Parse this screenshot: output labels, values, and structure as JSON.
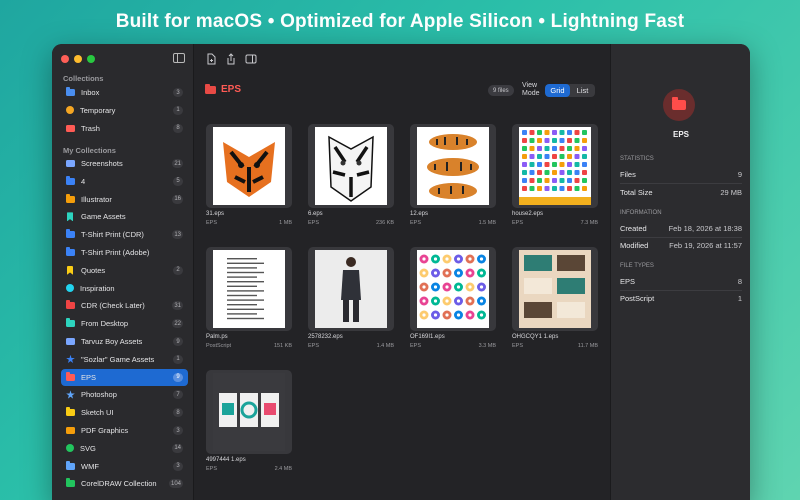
{
  "headline": "Built for macOS • Optimized for Apple Silicon • Lightning Fast",
  "sidebar": {
    "collections_title": "Collections",
    "collections": [
      {
        "label": "Inbox",
        "count": "3",
        "icon": "tray-icon",
        "color": "#4a8ef0"
      },
      {
        "label": "Temporary",
        "count": "1",
        "icon": "clock-icon",
        "color": "#f5a623"
      },
      {
        "label": "Trash",
        "count": "8",
        "icon": "trash-icon",
        "color": "#ff5b55"
      }
    ],
    "my_collections_title": "My Collections",
    "my_collections": [
      {
        "label": "Screenshots",
        "count": "21",
        "icon": "paperclip-icon",
        "color": "#7aa6ff"
      },
      {
        "label": "4",
        "count": "5",
        "icon": "folder-icon",
        "color": "#3b82f6"
      },
      {
        "label": "Illustrator",
        "count": "16",
        "icon": "folder-icon",
        "color": "#f59e0b"
      },
      {
        "label": "Game Assets",
        "count": "",
        "icon": "bookmark-icon",
        "color": "#2dd4bf"
      },
      {
        "label": "T-Shirt Print (CDR)",
        "count": "13",
        "icon": "folder-icon",
        "color": "#3b82f6"
      },
      {
        "label": "T-Shirt Print (Adobe)",
        "count": "",
        "icon": "folder-icon",
        "color": "#3b82f6"
      },
      {
        "label": "Quotes",
        "count": "2",
        "icon": "bookmark-icon",
        "color": "#facc15"
      },
      {
        "label": "Inspiration",
        "count": "",
        "icon": "heart-icon",
        "color": "#22d3ee"
      },
      {
        "label": "CDR (Check Later)",
        "count": "31",
        "icon": "folder-icon",
        "color": "#ef4444"
      },
      {
        "label": "From Desktop",
        "count": "22",
        "icon": "folder-icon",
        "color": "#2dd4bf"
      },
      {
        "label": "Tarvuz Boy Assets",
        "count": "9",
        "icon": "paperclip-icon",
        "color": "#7aa6ff"
      },
      {
        "label": "\"Sozlar\" Game Assets",
        "count": "1",
        "icon": "star-icon",
        "color": "#3b82f6"
      },
      {
        "label": "EPS",
        "count": "9",
        "icon": "folder-icon",
        "color": "#ff5b55",
        "active": true
      },
      {
        "label": "Photoshop",
        "count": "7",
        "icon": "star-icon",
        "color": "#60a5fa"
      },
      {
        "label": "Sketch UI",
        "count": "8",
        "icon": "folder-icon",
        "color": "#facc15"
      },
      {
        "label": "PDF Graphics",
        "count": "3",
        "icon": "paperclip-icon",
        "color": "#f59e0b"
      },
      {
        "label": "SVG",
        "count": "14",
        "icon": "heart-icon",
        "color": "#22c55e"
      },
      {
        "label": "WMF",
        "count": "3",
        "icon": "folder-icon",
        "color": "#60a5fa"
      },
      {
        "label": "CorelDRAW Collection",
        "count": "104",
        "icon": "folder-icon",
        "color": "#22c55e"
      }
    ]
  },
  "main": {
    "title": "EPS",
    "files_badge": "9 files",
    "view_mode_label": "View Mode",
    "view_grid": "Grid",
    "view_list": "List",
    "files": [
      {
        "name": "31.eps",
        "type": "EPS",
        "size": "1 MB",
        "thumb": "tiger-face"
      },
      {
        "name": "6.eps",
        "type": "EPS",
        "size": "236 KB",
        "thumb": "white-tiger"
      },
      {
        "name": "12.eps",
        "type": "EPS",
        "size": "1.5 MB",
        "thumb": "tigers"
      },
      {
        "name": "house2.eps",
        "type": "EPS",
        "size": "7.3 MB",
        "thumb": "icons-grid"
      },
      {
        "name": "Palm.ps",
        "type": "PostScript",
        "size": "151 KB",
        "thumb": "text-doc"
      },
      {
        "name": "2578232.eps",
        "type": "EPS",
        "size": "1.4 MB",
        "thumb": "person"
      },
      {
        "name": "OF169I1.eps",
        "type": "EPS",
        "size": "3.3 MB",
        "thumb": "flowers"
      },
      {
        "name": "OHGCQY1 1.eps",
        "type": "EPS",
        "size": "11.7 MB",
        "thumb": "cards"
      },
      {
        "name": "4997444 1.eps",
        "type": "EPS",
        "size": "2.4 MB",
        "thumb": "design"
      }
    ]
  },
  "inspector": {
    "name": "EPS",
    "statistics_title": "STATISTICS",
    "files_label": "Files",
    "files_value": "9",
    "total_size_label": "Total Size",
    "total_size_value": "29 MB",
    "information_title": "INFORMATION",
    "created_label": "Created",
    "created_value": "Feb 18, 2026 at 18:38",
    "modified_label": "Modified",
    "modified_value": "Feb 19, 2026 at 11:57",
    "file_types_title": "FILE TYPES",
    "types": [
      {
        "label": "EPS",
        "count": "8"
      },
      {
        "label": "PostScript",
        "count": "1"
      }
    ]
  }
}
